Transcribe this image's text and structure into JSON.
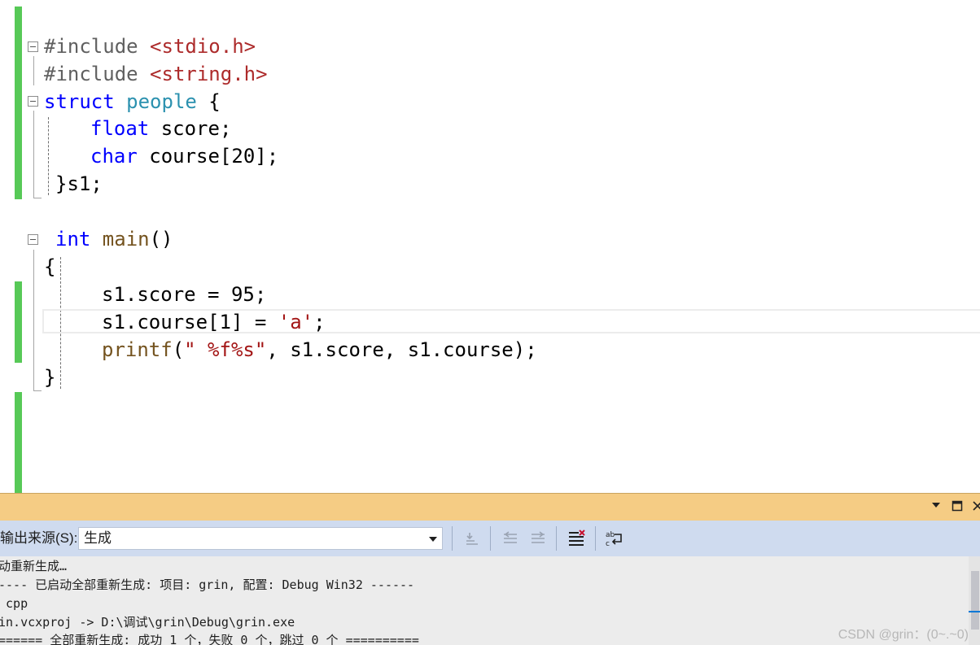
{
  "editor": {
    "lines": [
      {
        "tokens": [
          {
            "t": "#include ",
            "c": "pre"
          },
          {
            "t": "<stdio.h>",
            "c": "inc"
          }
        ]
      },
      {
        "tokens": [
          {
            "t": "#include ",
            "c": "pre"
          },
          {
            "t": "<string.h>",
            "c": "inc"
          }
        ]
      },
      {
        "tokens": [
          {
            "t": "struct ",
            "c": "kw"
          },
          {
            "t": "people",
            "c": "typ"
          },
          {
            "t": " {",
            "c": ""
          }
        ]
      },
      {
        "tokens": [
          {
            "t": "float",
            "c": "kw"
          },
          {
            "t": " score;",
            "c": ""
          }
        ]
      },
      {
        "tokens": [
          {
            "t": "char",
            "c": "kw"
          },
          {
            "t": " course[20];",
            "c": ""
          }
        ]
      },
      {
        "tokens": [
          {
            "t": "}s1;",
            "c": ""
          }
        ]
      },
      {
        "tokens": [
          {
            "t": "int ",
            "c": "kw"
          },
          {
            "t": "main",
            "c": "fn"
          },
          {
            "t": "()",
            "c": ""
          }
        ]
      },
      {
        "tokens": [
          {
            "t": "{",
            "c": ""
          }
        ]
      },
      {
        "tokens": [
          {
            "t": "s1.score = 95;",
            "c": ""
          }
        ]
      },
      {
        "tokens": [
          {
            "t": "s1.course[1] = ",
            "c": ""
          },
          {
            "t": "'a'",
            "c": "str"
          },
          {
            "t": ";",
            "c": ""
          }
        ]
      },
      {
        "tokens": [
          {
            "t": "printf",
            "c": "fn"
          },
          {
            "t": "(",
            "c": ""
          },
          {
            "t": "\" %f%s\"",
            "c": "str"
          },
          {
            "t": ", s1.score, s1.course);",
            "c": ""
          }
        ]
      },
      {
        "tokens": [
          {
            "t": "}",
            "c": ""
          }
        ]
      }
    ]
  },
  "output_panel": {
    "source_label": "输出来源(S):",
    "source_value": "生成",
    "icons": [
      "dropdown-arrow-icon",
      "maximize-icon",
      "close-icon",
      "goto-message-icon",
      "previous-message-icon",
      "next-message-icon",
      "clear-all-icon",
      "word-wrap-icon"
    ],
    "lines": [
      "动重新生成…",
      "---- 已启动全部重新生成: 项目: grin, 配置: Debug Win32 ------",
      " cpp",
      "in.vcxproj -> D:\\调试\\grin\\Debug\\grin.exe",
      "====== 全部重新生成: 成功 1 个，失败 0 个，跳过 0 个 =========="
    ],
    "watermark": "CSDN @grin：(0~.~0)"
  }
}
